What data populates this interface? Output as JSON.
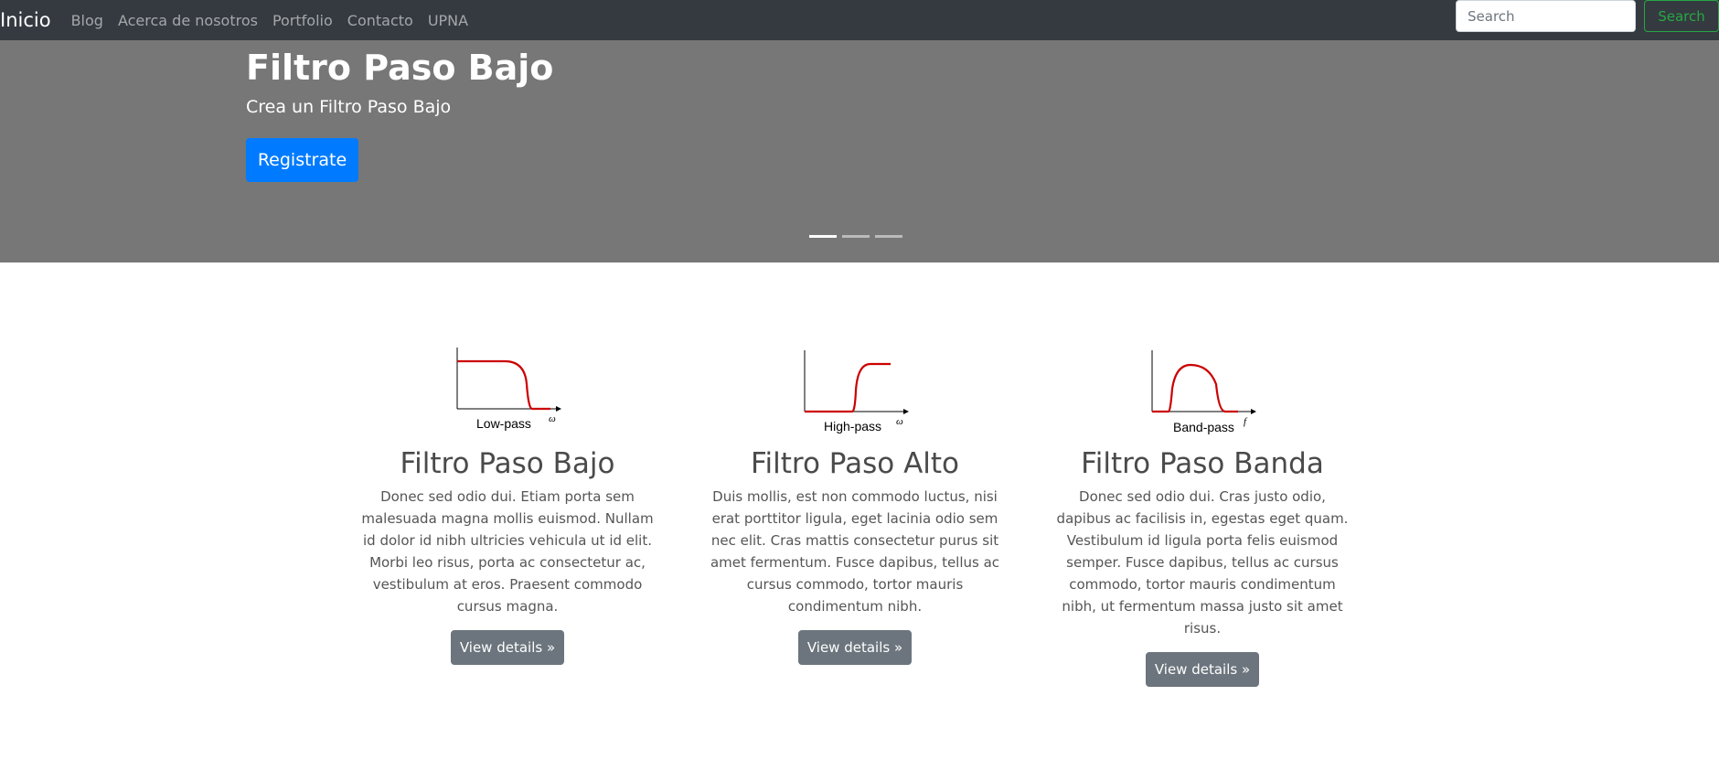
{
  "navbar": {
    "brand": "Inicio",
    "links": [
      "Blog",
      "Acerca de nosotros",
      "Portfolio",
      "Contacto",
      "UPNA"
    ],
    "search_placeholder": "Search",
    "search_button": "Search",
    "search_button_color": "#28a745"
  },
  "hero": {
    "title": "Filtro Paso Bajo",
    "subtitle": "Crea un Filtro Paso Bajo",
    "button": "Registrate",
    "button_color": "#007bff",
    "background": "#777777",
    "slides_total": 3,
    "active_slide": 1
  },
  "columns": [
    {
      "image_label": "Low-pass",
      "axis_symbol": "ω",
      "title": "Filtro Paso Bajo",
      "text": "Donec sed odio dui. Etiam porta sem malesuada magna mollis euismod. Nullam id dolor id nibh ultricies vehicula ut id elit. Morbi leo risus, porta ac consectetur ac, vestibulum at eros. Praesent commodo cursus magna.",
      "button": "View details »"
    },
    {
      "image_label": "High-pass",
      "axis_symbol": "ω",
      "title": "Filtro Paso Alto",
      "text": "Duis mollis, est non commodo luctus, nisi erat porttitor ligula, eget lacinia odio sem nec elit. Cras mattis consectetur purus sit amet fermentum. Fusce dapibus, tellus ac cursus commodo, tortor mauris condimentum nibh.",
      "button": "View details »"
    },
    {
      "image_label": "Band-pass",
      "axis_symbol": "f",
      "title": "Filtro Paso Banda",
      "text": "Donec sed odio dui. Cras justo odio, dapibus ac facilisis in, egestas eget quam. Vestibulum id ligula porta felis euismod semper. Fusce dapibus, tellus ac cursus commodo, tortor mauris condimentum nibh, ut fermentum massa justo sit amet risus.",
      "button": "View details »"
    }
  ],
  "colors": {
    "navbar_bg": "#343a40",
    "curve": "#cc0000",
    "details_button": "#6c757d"
  }
}
